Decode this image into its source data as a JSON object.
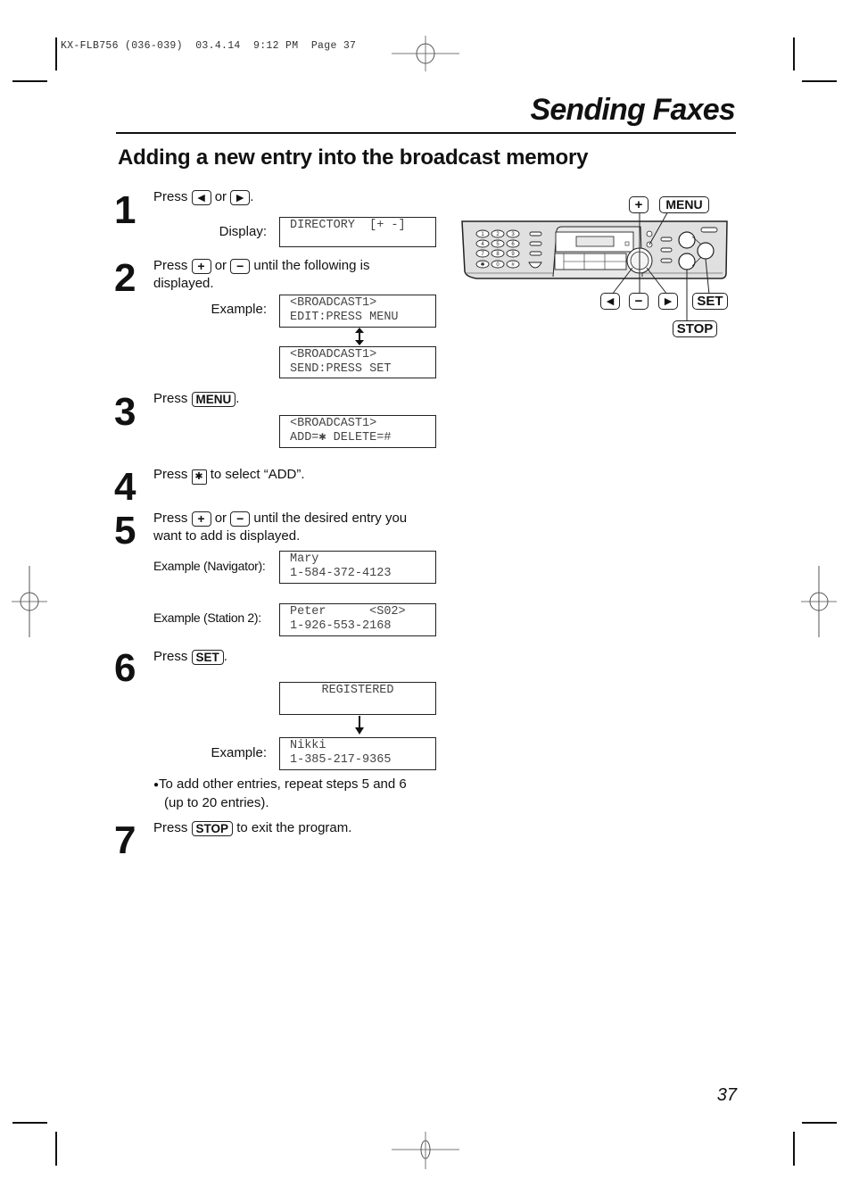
{
  "print_slug": "KX-FLB756 (036-039)  03.4.14  9:12 PM  Page 37",
  "section_title": "Sending Faxes",
  "page_heading": "Adding a new entry into the broadcast memory",
  "page_number": "37",
  "icons": {
    "left_arrow": "◄",
    "right_arrow": "►",
    "plus": "+",
    "minus": "−",
    "star": "✱",
    "bullet": "●",
    "up_down_arrow": "↕",
    "down_arrow": "↓"
  },
  "keys": {
    "menu": "MENU",
    "set": "SET",
    "stop": "STOP"
  },
  "steps": [
    {
      "number": "1",
      "parts": {
        "press": "Press",
        "or": "or",
        "end": "."
      },
      "display_label": "Display:",
      "displays": [
        {
          "line1": "DIRECTORY  [+ -]",
          "line2": ""
        }
      ]
    },
    {
      "number": "2",
      "parts": {
        "press": "Press",
        "or": "or",
        "rest": "until the following is",
        "rest2": "displayed."
      },
      "display_label": "Example:",
      "displays": [
        {
          "line1": "<BROADCAST1>",
          "line2": "EDIT:PRESS MENU"
        },
        {
          "line1": "<BROADCAST1>",
          "line2": "SEND:PRESS SET"
        }
      ]
    },
    {
      "number": "3",
      "parts": {
        "press": "Press",
        "end": "."
      },
      "displays": [
        {
          "line1": "<BROADCAST1>",
          "line2": "ADD=✱ DELETE=#"
        }
      ]
    },
    {
      "number": "4",
      "parts": {
        "press": "Press",
        "rest": "to select “ADD”."
      }
    },
    {
      "number": "5",
      "parts": {
        "press": "Press",
        "or": "or",
        "rest": "until the desired entry you",
        "rest2": "want to add is displayed."
      },
      "examples": [
        {
          "label": "Example (Navigator):",
          "line1": "Mary",
          "line2": "1-584-372-4123"
        },
        {
          "label": "Example (Station 2):",
          "line1": "Peter      <S02>",
          "line2": "1-926-553-2168"
        }
      ]
    },
    {
      "number": "6",
      "parts": {
        "press": "Press",
        "end": "."
      },
      "displays": [
        {
          "line1": "REGISTERED",
          "line2": ""
        }
      ],
      "example_label": "Example:",
      "example_display": {
        "line1": "Nikki",
        "line2": "1-385-217-9365"
      },
      "note_line1": "To add other entries, repeat steps 5 and 6",
      "note_line2": "(up to 20 entries)."
    },
    {
      "number": "7",
      "parts": {
        "press": "Press",
        "rest": "to exit the program."
      }
    }
  ],
  "panel_diagram": {
    "labels": {
      "plus": "+",
      "menu": "MENU",
      "left": "◄",
      "minus": "−",
      "right": "►",
      "set": "SET",
      "stop": "STOP"
    },
    "dial_keys": [
      "1",
      "2",
      "3",
      "4",
      "5",
      "6",
      "7",
      "8",
      "9",
      "✱",
      "0",
      "#"
    ]
  }
}
